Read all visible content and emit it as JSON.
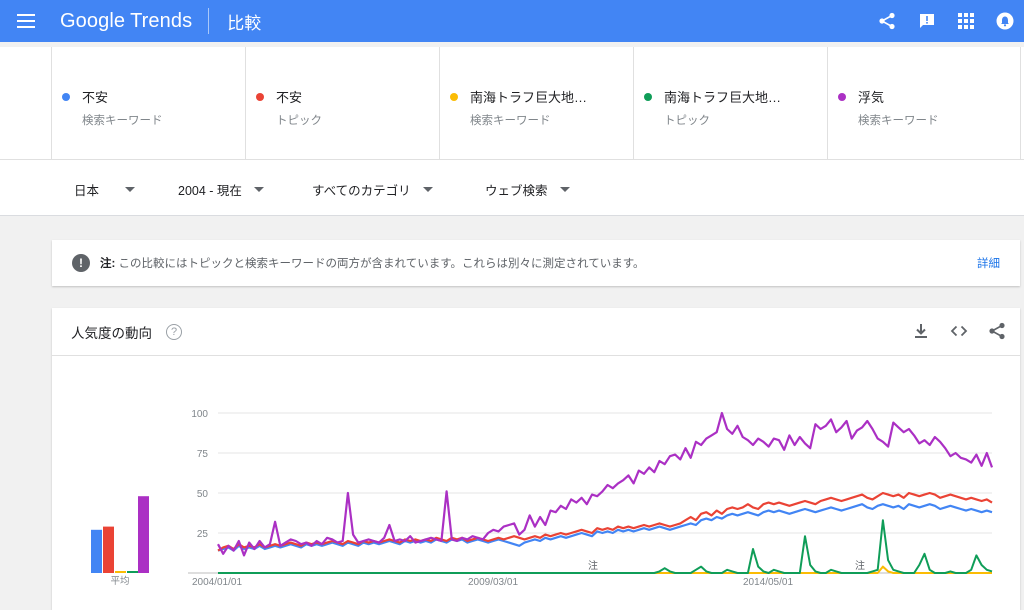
{
  "appbar": {
    "logo_google": "Google",
    "logo_trends": "Trends",
    "title": "比較",
    "colors": {
      "bar": "#4285f4"
    }
  },
  "terms": [
    {
      "name": "不安",
      "type": "検索キーワード",
      "color": "#4285f4"
    },
    {
      "name": "不安",
      "type": "トピック",
      "color": "#ea4335"
    },
    {
      "name": "南海トラフ巨大地…",
      "type": "検索キーワード",
      "color": "#fbbc04"
    },
    {
      "name": "南海トラフ巨大地…",
      "type": "トピック",
      "color": "#0f9d58"
    },
    {
      "name": "浮気",
      "type": "検索キーワード",
      "color": "#ab30c4"
    }
  ],
  "filters": {
    "region": "日本",
    "time": "2004 - 現在",
    "category": "すべてのカテゴリ",
    "search_type": "ウェブ検索"
  },
  "note": {
    "prefix": "注:",
    "text": "この比較にはトピックと検索キーワードの両方が含まれています。これらは別々に測定されています。",
    "link": "詳細"
  },
  "card": {
    "title": "人気度の動向",
    "help": "?"
  },
  "chart_data": {
    "type": "line",
    "ylim": [
      0,
      100
    ],
    "yticks": [
      "100",
      "75",
      "50",
      "25"
    ],
    "xlabels": [
      "2004/01/01",
      "2009/03/01",
      "2014/05/01"
    ],
    "annotations": [
      "注",
      "注"
    ],
    "average_label": "平均",
    "averages": [
      {
        "name": "不安",
        "value": 27,
        "color": "#4285f4"
      },
      {
        "name": "不安",
        "value": 29,
        "color": "#ea4335"
      },
      {
        "name": "南海トラフ巨大地…",
        "value": 0,
        "color": "#fbbc04"
      },
      {
        "name": "南海トラフ巨大地…",
        "value": 1,
        "color": "#0f9d58"
      },
      {
        "name": "浮気",
        "value": 48,
        "color": "#ab30c4"
      }
    ],
    "series": [
      {
        "color": "#4285f4",
        "width": 2.2,
        "values": [
          14,
          15,
          16,
          14,
          17,
          15,
          16,
          15,
          17,
          15,
          16,
          17,
          16,
          17,
          18,
          17,
          16,
          18,
          17,
          18,
          17,
          18,
          19,
          18,
          17,
          19,
          18,
          17,
          19,
          18,
          19,
          18,
          19,
          20,
          19,
          18,
          20,
          19,
          20,
          19,
          20,
          19,
          21,
          20,
          19,
          21,
          20,
          21,
          19,
          20,
          21,
          20,
          19,
          20,
          21,
          20,
          19,
          18,
          17,
          19,
          20,
          21,
          20,
          22,
          21,
          22,
          23,
          22,
          23,
          24,
          25,
          24,
          23,
          26,
          25,
          26,
          25,
          27,
          26,
          27,
          26,
          27,
          28,
          27,
          28,
          29,
          28,
          27,
          28,
          29,
          30,
          31,
          30,
          33,
          34,
          33,
          35,
          34,
          36,
          37,
          36,
          37,
          38,
          37,
          36,
          38,
          39,
          38,
          39,
          38,
          37,
          38,
          39,
          40,
          39,
          38,
          39,
          40,
          41,
          40,
          39,
          40,
          41,
          42,
          43,
          41,
          40,
          42,
          43,
          42,
          41,
          42,
          40,
          43,
          42,
          41,
          42,
          43,
          42,
          40,
          41,
          42,
          41,
          40,
          39,
          40,
          39,
          38,
          39,
          38
        ]
      },
      {
        "color": "#ea4335",
        "width": 2.2,
        "values": [
          14,
          16,
          17,
          15,
          18,
          16,
          17,
          16,
          18,
          16,
          17,
          18,
          17,
          18,
          19,
          18,
          17,
          19,
          18,
          19,
          18,
          19,
          20,
          19,
          18,
          20,
          19,
          18,
          20,
          19,
          20,
          19,
          20,
          21,
          20,
          19,
          21,
          20,
          21,
          20,
          21,
          20,
          22,
          21,
          20,
          22,
          21,
          22,
          20,
          21,
          22,
          21,
          20,
          21,
          22,
          21,
          22,
          23,
          22,
          21,
          22,
          23,
          22,
          24,
          23,
          24,
          25,
          24,
          25,
          26,
          27,
          26,
          25,
          28,
          27,
          28,
          27,
          29,
          28,
          29,
          28,
          29,
          30,
          29,
          30,
          31,
          30,
          29,
          30,
          31,
          33,
          35,
          33,
          37,
          38,
          36,
          39,
          37,
          40,
          41,
          40,
          41,
          43,
          41,
          40,
          43,
          44,
          43,
          44,
          43,
          42,
          43,
          44,
          45,
          44,
          43,
          45,
          46,
          47,
          46,
          45,
          46,
          47,
          48,
          49,
          47,
          46,
          48,
          50,
          49,
          48,
          49,
          47,
          50,
          49,
          48,
          49,
          50,
          49,
          47,
          48,
          49,
          48,
          47,
          46,
          47,
          46,
          45,
          46,
          44
        ]
      },
      {
        "color": "#fbbc04",
        "width": 2.0,
        "values": [
          0,
          0,
          0,
          0,
          0,
          0,
          0,
          0,
          0,
          0,
          0,
          0,
          0,
          0,
          0,
          0,
          0,
          0,
          0,
          0,
          0,
          0,
          0,
          0,
          0,
          0,
          0,
          0,
          0,
          0,
          0,
          0,
          0,
          0,
          0,
          0,
          0,
          0,
          0,
          0,
          0,
          0,
          0,
          0,
          0,
          0,
          0,
          0,
          0,
          0,
          0,
          0,
          0,
          0,
          0,
          0,
          0,
          0,
          0,
          0,
          0,
          0,
          0,
          0,
          0,
          0,
          0,
          0,
          0,
          0,
          0,
          0,
          0,
          0,
          0,
          0,
          0,
          0,
          0,
          0,
          0,
          0,
          0,
          0,
          0,
          0,
          0,
          0,
          0,
          0,
          0,
          0,
          0,
          0,
          0,
          0,
          0,
          0,
          0,
          0,
          0,
          0,
          0,
          0,
          0,
          0,
          0,
          0,
          0,
          0,
          0,
          0,
          0,
          0,
          0,
          0,
          0,
          0,
          0,
          0,
          0,
          0,
          0,
          0,
          0,
          0,
          0,
          0,
          4,
          1,
          0,
          0,
          0,
          0,
          0,
          0,
          0,
          0,
          0,
          0,
          0,
          0,
          0,
          0,
          0,
          0,
          0,
          0,
          0,
          0
        ]
      },
      {
        "color": "#0f9d58",
        "width": 2.0,
        "values": [
          0,
          0,
          0,
          0,
          0,
          0,
          0,
          0,
          0,
          0,
          0,
          0,
          0,
          0,
          0,
          0,
          0,
          0,
          0,
          0,
          0,
          0,
          0,
          0,
          0,
          0,
          0,
          0,
          0,
          0,
          0,
          0,
          0,
          0,
          0,
          0,
          0,
          0,
          0,
          0,
          0,
          0,
          0,
          0,
          0,
          0,
          0,
          0,
          0,
          0,
          0,
          0,
          0,
          0,
          0,
          0,
          0,
          0,
          0,
          0,
          0,
          0,
          0,
          0,
          0,
          0,
          0,
          0,
          0,
          0,
          0,
          0,
          0,
          0,
          0,
          0,
          0,
          0,
          0,
          0,
          0,
          0,
          0,
          0,
          0,
          1,
          3,
          1,
          0,
          0,
          0,
          0,
          2,
          4,
          1,
          0,
          0,
          0,
          2,
          1,
          0,
          0,
          0,
          15,
          4,
          1,
          0,
          2,
          1,
          0,
          0,
          0,
          0,
          23,
          5,
          1,
          0,
          0,
          2,
          1,
          0,
          0,
          0,
          0,
          0,
          0,
          1,
          2,
          33,
          8,
          2,
          1,
          0,
          0,
          0,
          5,
          12,
          2,
          0,
          0,
          0,
          1,
          0,
          0,
          0,
          2,
          11,
          5,
          2,
          1
        ]
      },
      {
        "color": "#ab30c4",
        "width": 2.2,
        "values": [
          18,
          12,
          17,
          14,
          20,
          11,
          19,
          15,
          20,
          16,
          18,
          32,
          17,
          19,
          21,
          20,
          18,
          19,
          17,
          20,
          18,
          22,
          21,
          19,
          20,
          50,
          24,
          19,
          20,
          21,
          20,
          19,
          22,
          30,
          20,
          21,
          20,
          23,
          19,
          20,
          21,
          22,
          21,
          20,
          51,
          21,
          20,
          22,
          21,
          23,
          22,
          21,
          25,
          27,
          26,
          29,
          30,
          31,
          24,
          27,
          36,
          29,
          35,
          30,
          39,
          38,
          42,
          40,
          46,
          44,
          47,
          43,
          49,
          48,
          51,
          55,
          53,
          56,
          58,
          61,
          56,
          64,
          62,
          66,
          63,
          70,
          68,
          73,
          74,
          71,
          78,
          72,
          82,
          80,
          84,
          86,
          88,
          100,
          90,
          87,
          92,
          85,
          83,
          80,
          84,
          82,
          79,
          84,
          83,
          77,
          86,
          80,
          85,
          81,
          78,
          93,
          90,
          92,
          96,
          88,
          91,
          95,
          84,
          89,
          91,
          95,
          90,
          84,
          82,
          79,
          94,
          91,
          88,
          90,
          86,
          81,
          83,
          80,
          85,
          82,
          78,
          73,
          75,
          72,
          71,
          69,
          74,
          67,
          75,
          66
        ]
      }
    ]
  }
}
